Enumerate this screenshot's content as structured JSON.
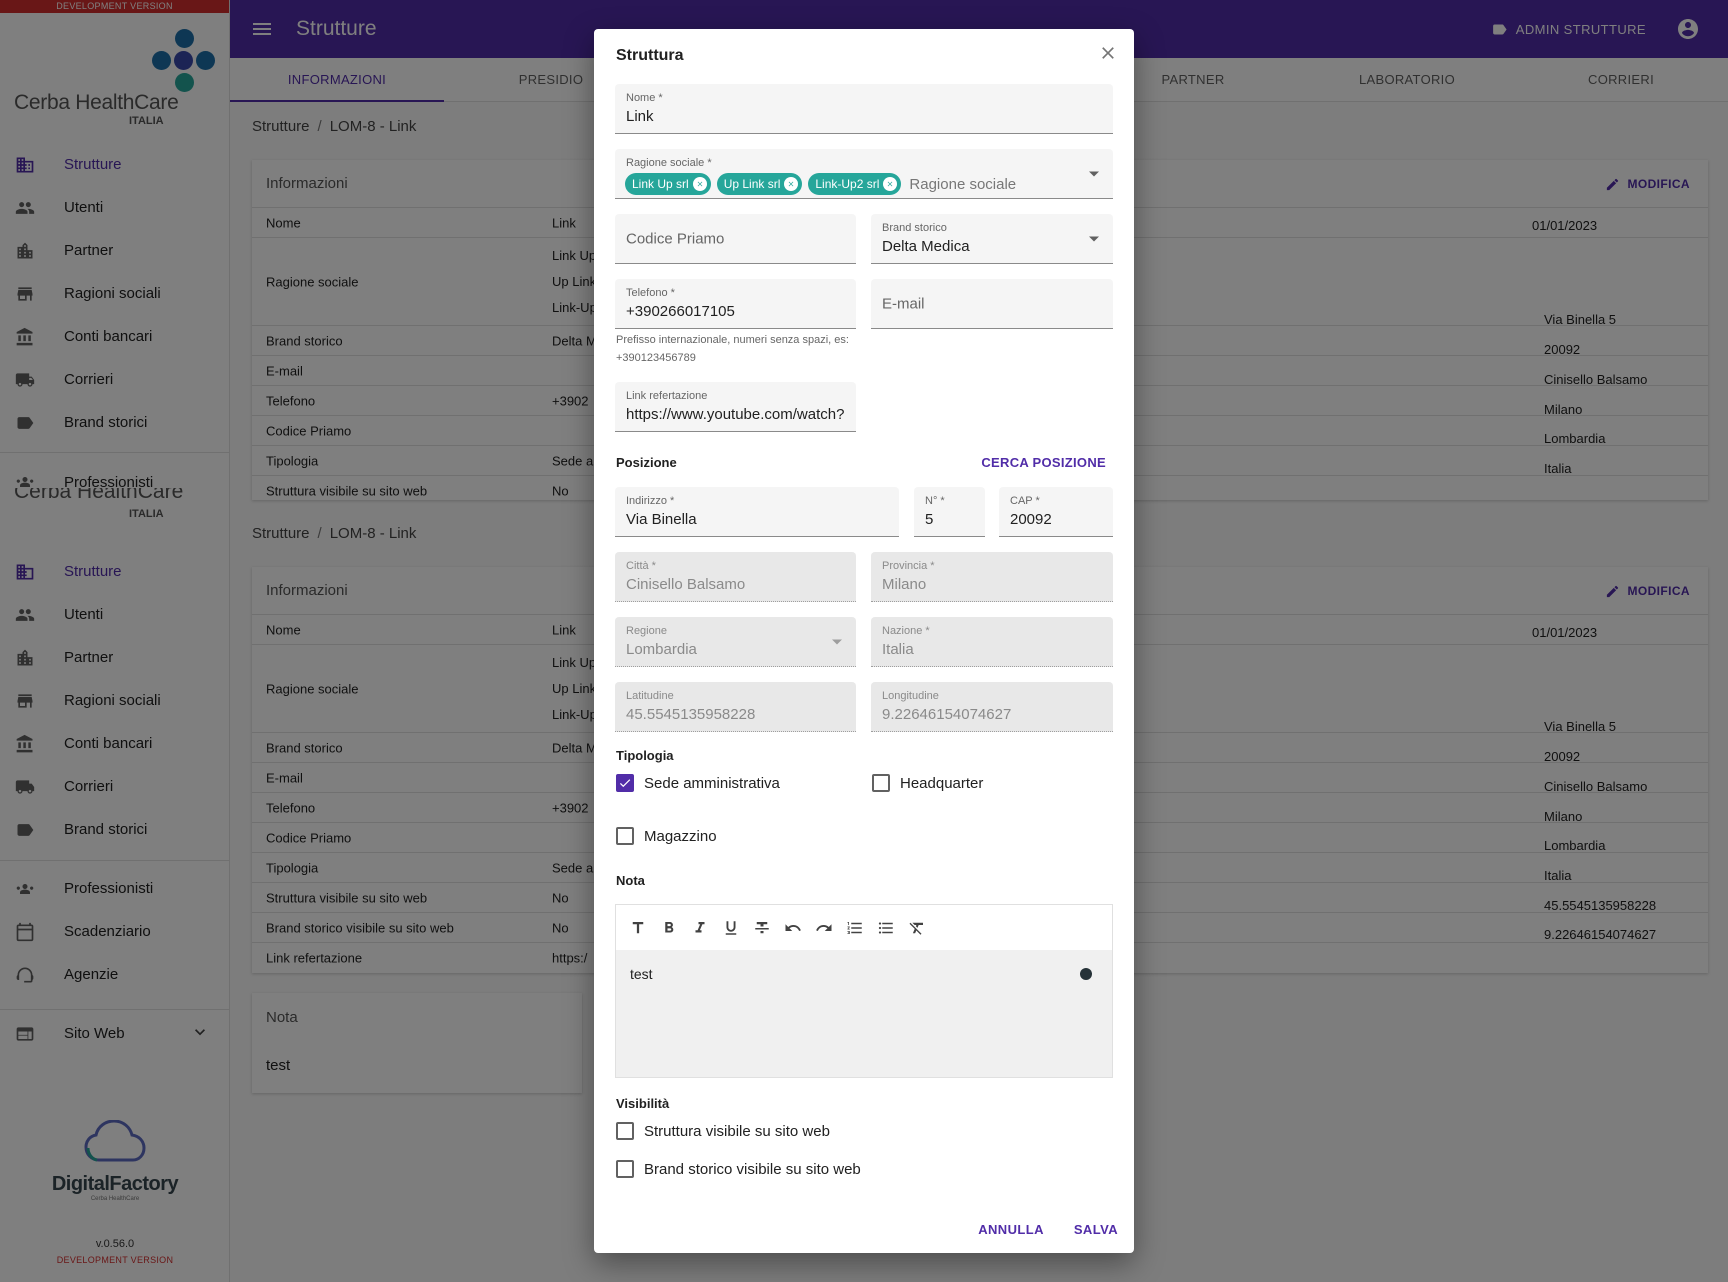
{
  "sidebar": {
    "dev_banner": "DEVELOPMENT VERSION",
    "logo_text": "Cerba HealthCare",
    "logo_sub": "ITALIA",
    "items": [
      {
        "label": "Strutture",
        "icon": "building-icon"
      },
      {
        "label": "Utenti",
        "icon": "people-icon"
      },
      {
        "label": "Partner",
        "icon": "domain-icon"
      },
      {
        "label": "Ragioni sociali",
        "icon": "store-icon"
      },
      {
        "label": "Conti bancari",
        "icon": "bank-icon"
      },
      {
        "label": "Corrieri",
        "icon": "truck-icon"
      },
      {
        "label": "Brand storici",
        "icon": "label-icon"
      }
    ],
    "items2": [
      {
        "label": "Professionisti",
        "icon": "groups-icon"
      },
      {
        "label": "Scadenziario",
        "icon": "calendar-icon"
      },
      {
        "label": "Agenzie",
        "icon": "support-agent-icon"
      }
    ],
    "sito_web": "Sito Web",
    "df_logo": "DigitalFactory",
    "df_small": "Cerba HealthCare",
    "version": "v.0.56.0",
    "dev_footer": "DEVELOPMENT VERSION"
  },
  "header": {
    "title": "Strutture",
    "admin": "ADMIN STRUTTURE"
  },
  "tabs": [
    "INFORMAZIONI",
    "PRESIDIO",
    "",
    "",
    "PARTNER",
    "LABORATORIO",
    "CORRIERI"
  ],
  "main": {
    "breadcrumb": [
      "Strutture",
      "LOM-8 - Link"
    ],
    "card_title": "Informazioni",
    "modifica": "MODIFICA",
    "rows": [
      {
        "k": "Nome",
        "v": "Link"
      },
      {
        "k": "Ragione sociale",
        "v": ""
      },
      {
        "k": "Brand storico",
        "v": "Delta M"
      },
      {
        "k": "E-mail",
        "v": ""
      },
      {
        "k": "Telefono",
        "v": "+3902"
      },
      {
        "k": "Codice Priamo",
        "v": ""
      },
      {
        "k": "Tipologia",
        "v": "Sede a"
      },
      {
        "k": "Struttura visibile su sito web",
        "v": "No"
      },
      {
        "k": "Brand storico visibile su sito web",
        "v": "No"
      },
      {
        "k": "Link refertazione",
        "v": "https:/"
      }
    ],
    "ragione_lines": [
      "Link Up",
      "Up Link",
      "Link-Up"
    ],
    "right_date": "01/01/2023",
    "right_values": [
      "Via Binella 5",
      "20092",
      "Cinisello Balsamo",
      "Milano",
      "Lombardia",
      "Italia",
      "45.5545135958228",
      "9.22646154074627"
    ],
    "nota_title": "Nota",
    "nota_text": "test"
  },
  "dialog": {
    "title": "Struttura",
    "nome": {
      "label": "Nome *",
      "value": "Link"
    },
    "ragione": {
      "label": "Ragione sociale *",
      "chips": [
        "Link Up srl",
        "Up Link srl",
        "Link-Up2 srl"
      ],
      "placeholder": "Ragione sociale"
    },
    "codice_priamo": {
      "placeholder": "Codice Priamo"
    },
    "brand_storico": {
      "label": "Brand storico",
      "value": "Delta Medica"
    },
    "telefono": {
      "label": "Telefono *",
      "value": "+390266017105",
      "helper": "Prefisso internazionale, numeri senza spazi, es: +390123456789"
    },
    "email": {
      "placeholder": "E-mail"
    },
    "link": {
      "label": "Link refertazione",
      "value": "https://www.youtube.com/watch?"
    },
    "posizione": "Posizione",
    "cerca": "CERCA POSIZIONE",
    "indirizzo": {
      "label": "Indirizzo *",
      "value": "Via Binella"
    },
    "numero": {
      "label": "N° *",
      "value": "5"
    },
    "cap": {
      "label": "CAP *",
      "value": "20092"
    },
    "citta": {
      "label": "Città *",
      "value": "Cinisello Balsamo"
    },
    "provincia": {
      "label": "Provincia *",
      "value": "Milano"
    },
    "regione": {
      "label": "Regione",
      "value": "Lombardia"
    },
    "nazione": {
      "label": "Nazione *",
      "value": "Italia"
    },
    "latitudine": {
      "label": "Latitudine",
      "value": "45.5545135958228"
    },
    "longitudine": {
      "label": "Longitudine",
      "value": "9.22646154074627"
    },
    "tipologia": "Tipologia",
    "sede": {
      "label": "Sede amministrativa",
      "checked": true
    },
    "headquarter": {
      "label": "Headquarter",
      "checked": false
    },
    "magazzino": {
      "label": "Magazzino",
      "checked": false
    },
    "nota": "Nota",
    "nota_text": "test",
    "visibilita": "Visibilità",
    "vis_struttura": {
      "label": "Struttura visibile su sito web",
      "checked": false
    },
    "vis_brand": {
      "label": "Brand storico visibile su sito web",
      "checked": false
    },
    "annulla": "ANNULLA",
    "salva": "SALVA"
  },
  "colors": {
    "primary": "#512da8",
    "chip": "#26a69a",
    "dev": "#d32f2f"
  }
}
